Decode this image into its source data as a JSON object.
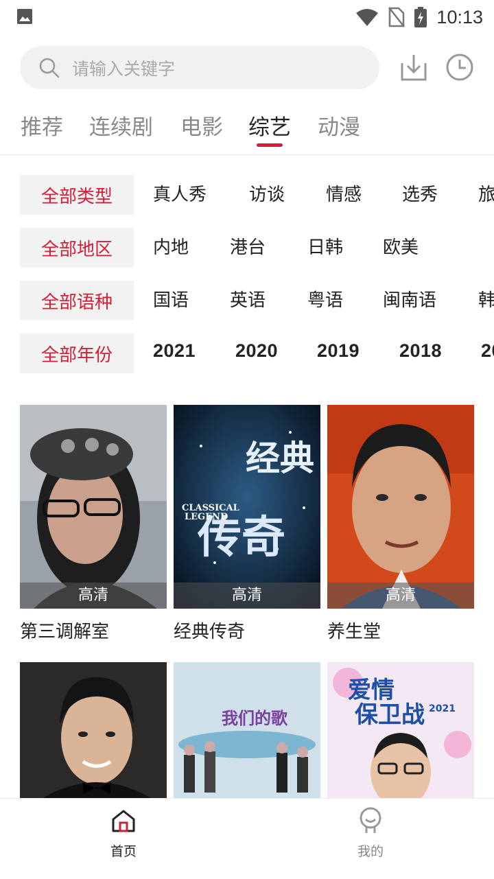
{
  "status": {
    "time": "10:13"
  },
  "search": {
    "placeholder": "请输入关键字"
  },
  "tabs": [
    {
      "label": "推荐",
      "active": false
    },
    {
      "label": "连续剧",
      "active": false
    },
    {
      "label": "电影",
      "active": false
    },
    {
      "label": "综艺",
      "active": true
    },
    {
      "label": "动漫",
      "active": false
    }
  ],
  "filters": {
    "type": {
      "head": "全部类型",
      "options": [
        "真人秀",
        "访谈",
        "情感",
        "选秀",
        "旅"
      ]
    },
    "region": {
      "head": "全部地区",
      "options": [
        "内地",
        "港台",
        "日韩",
        "欧美"
      ]
    },
    "language": {
      "head": "全部语种",
      "options": [
        "国语",
        "英语",
        "粤语",
        "闽南语",
        "韩"
      ]
    },
    "year": {
      "head": "全部年份",
      "options": [
        "2021",
        "2020",
        "2019",
        "2018",
        "20"
      ]
    }
  },
  "shows": [
    {
      "title": "第三调解室",
      "quality": "高清"
    },
    {
      "title": "经典传奇",
      "quality": "高清",
      "poster_text": [
        "经典",
        "传奇",
        "CLASSICAL",
        "LEGEND"
      ]
    },
    {
      "title": "养生堂",
      "quality": "高清"
    },
    {
      "title": "",
      "quality": ""
    },
    {
      "title": "",
      "quality": "",
      "poster_text": [
        "我们的歌"
      ]
    },
    {
      "title": "",
      "quality": "",
      "poster_text": [
        "爱情",
        "保卫战",
        "2021"
      ]
    }
  ],
  "bottom_nav": [
    {
      "label": "首页",
      "active": true
    },
    {
      "label": "我的",
      "active": false
    }
  ],
  "colors": {
    "accent": "#d11f37",
    "inactive_tab": "#888888"
  }
}
